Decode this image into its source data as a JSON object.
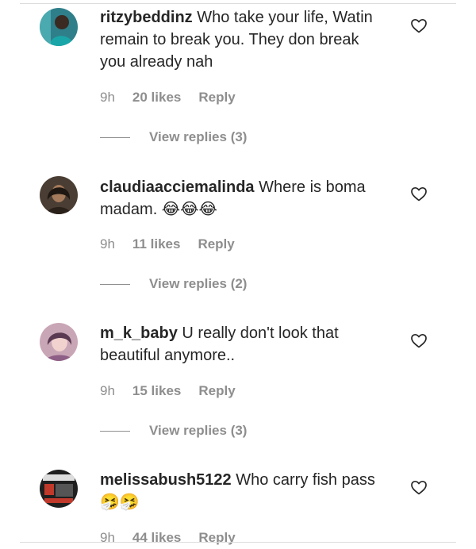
{
  "comments": [
    {
      "username": "ritzybeddinz",
      "text": "Who take your life, Watin remain to break you. They don break you already nah",
      "time": "9h",
      "likes": "20 likes",
      "reply": "Reply",
      "view_replies": "View replies (3)",
      "avatar_icon": "profile-photo"
    },
    {
      "username": "claudiaacciemalinda",
      "text": "Where is boma madam. 😂😂😂",
      "time": "9h",
      "likes": "11 likes",
      "reply": "Reply",
      "view_replies": "View replies (2)",
      "avatar_icon": "profile-photo"
    },
    {
      "username": "m_k_baby",
      "text": "U really don't look that beautiful anymore..",
      "time": "9h",
      "likes": "15 likes",
      "reply": "Reply",
      "view_replies": "View replies (3)",
      "avatar_icon": "profile-photo"
    },
    {
      "username": "melissabush5122",
      "text": "Who carry fish pass 🤧🤧",
      "time": "9h",
      "likes": "44 likes",
      "reply": "Reply",
      "avatar_icon": "profile-photo"
    }
  ],
  "icons": {
    "like": "heart-outline-icon"
  },
  "colors": {
    "text": "#262626",
    "meta": "#8e8e8e",
    "background": "#ffffff"
  }
}
